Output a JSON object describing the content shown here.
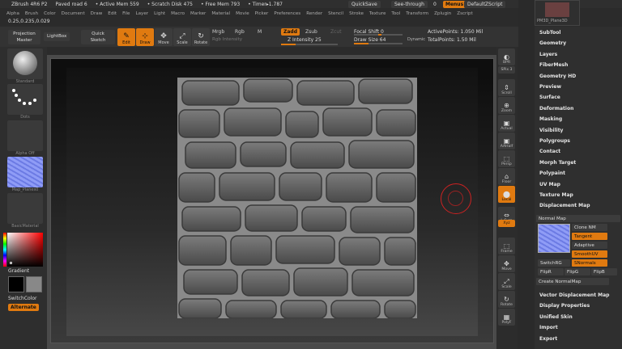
{
  "title": {
    "app": "ZBrush 4R6 P2",
    "doc": "Paved road 6",
    "active_mem": "• Active Mem 559",
    "scratch": "• Scratch Disk 475",
    "free_mem": "• Free Mem 793",
    "timer": "• Timer▸1.787"
  },
  "top_buttons": {
    "quicksave": "QuickSave",
    "seethrough": "See-through",
    "seethrough_val": "0",
    "menus": "Menus",
    "default_script": "DefaultZScript"
  },
  "menus": [
    "Alpha",
    "Brush",
    "Color",
    "Document",
    "Draw",
    "Edit",
    "File",
    "Layer",
    "Light",
    "Macro",
    "Marker",
    "Material",
    "Movie",
    "Picker",
    "Preferences",
    "Render",
    "Stencil",
    "Stroke",
    "Texture",
    "Tool",
    "Transform",
    "Zplugin",
    "Zscript"
  ],
  "coords": "0.25,0.235,0.029",
  "shelf": {
    "projection_master": "Projection Master",
    "lightbox": "LightBox",
    "quick_sketch": "Quick Sketch",
    "edit": "Edit",
    "draw": "Draw",
    "move": "Move",
    "scale": "Scale",
    "rotate": "Rotate",
    "mrgb": "Mrgb",
    "rgb": "Rgb",
    "m": "M",
    "rgb_intensity": "Rgb Intensity",
    "zadd": "Zadd",
    "zsub": "Zsub",
    "zcut": "Zcut",
    "z_intensity": "Z Intensity 25",
    "focal_shift": "Focal Shift 0",
    "draw_size": "Draw Size 64",
    "dynamic": "Dynamic",
    "active_points": "ActivePoints: 1.050 Mil",
    "total_points": "TotalPoints: 1.50 Mil"
  },
  "left": {
    "brush": "Standard",
    "stroke": "Dots",
    "alpha": "Alpha Off",
    "texture": "Map_Planes0",
    "material": "BasicMaterial",
    "gradient": "Gradient",
    "switchcolor": "SwitchColor",
    "alternate": "Alternate"
  },
  "right_shelf": [
    "BPR",
    "SPix 3",
    "Scroll",
    "Zoom",
    "Actual",
    "AAHalf",
    "Persp",
    "Floor",
    "Local",
    "L.Sym",
    "Xyz",
    "Frame",
    "Move",
    "Scale",
    "Rotate",
    "PolyF"
  ],
  "tray_top": "PM3D_Plane3D",
  "tool_menu": [
    "SubTool",
    "Geometry",
    "Layers",
    "FiberMesh",
    "Geometry HD",
    "Preview",
    "Surface",
    "Deformation",
    "Masking",
    "Visibility",
    "Polygroups",
    "Contact",
    "Morph Target",
    "Polypaint",
    "UV Map",
    "Texture Map",
    "Displacement Map"
  ],
  "normal_map": {
    "header": "Normal Map",
    "clone": "Clone NM",
    "tangent": "Tangent",
    "adaptive": "Adaptive",
    "smoothuv": "SmoothUV",
    "snormals": "SNormals",
    "switchrg": "SwitchRG",
    "thumb_label": "PM3D_Plane3D",
    "flipr": "FlipR",
    "flipg": "FlipG",
    "flipb": "FlipB",
    "create": "Create NormalMap"
  },
  "tool_menu_bottom": [
    "Vector Displacement Map",
    "Display Properties",
    "Unified Skin",
    "Import",
    "Export"
  ],
  "colors": {
    "accent": "#e07a10",
    "bg": "#2b2b2b"
  }
}
